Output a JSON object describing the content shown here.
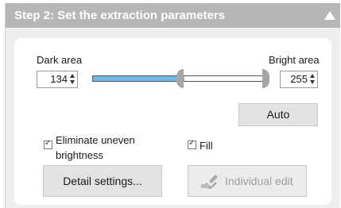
{
  "header": {
    "title": "Step 2: Set the extraction parameters",
    "collapse_icon": "chevron-up-icon"
  },
  "range": {
    "dark_label": "Dark area",
    "bright_label": "Bright area",
    "dark_value": "134",
    "bright_value": "255",
    "slider_min": 0,
    "slider_max": 255,
    "fill_color": "#6fb6ea"
  },
  "auto_button": "Auto",
  "options": {
    "eliminate_label_line1": "Eliminate uneven",
    "eliminate_label_line2": "brightness",
    "eliminate_checked": true,
    "fill_label": "Fill",
    "fill_checked": true
  },
  "buttons": {
    "detail_settings": "Detail settings...",
    "individual_edit": "Individual edit",
    "individual_edit_icon": "pencil-edit-icon"
  },
  "colors": {
    "header_bg": "#b7b7b7",
    "panel_bg": "#eeeeee"
  }
}
